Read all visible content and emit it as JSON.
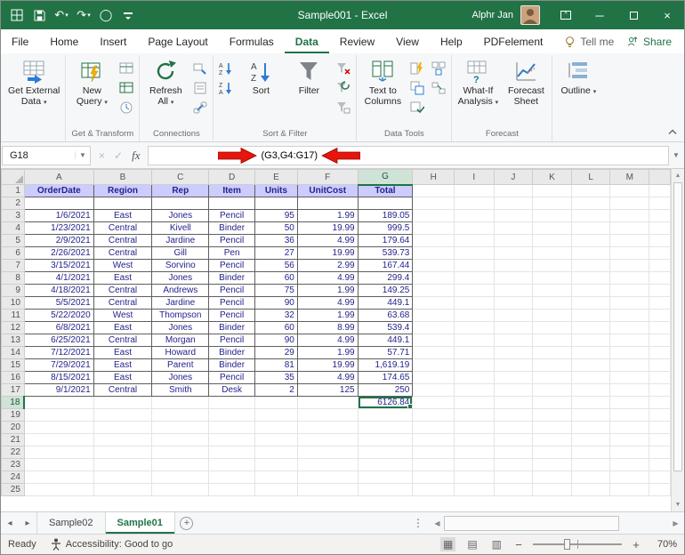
{
  "title_bar": {
    "title": "Sample001  -  Excel",
    "user_name": "Alphr Jan"
  },
  "ribbon_tabs": {
    "items": [
      {
        "label": "File",
        "active": false
      },
      {
        "label": "Home",
        "active": false
      },
      {
        "label": "Insert",
        "active": false
      },
      {
        "label": "Page Layout",
        "active": false
      },
      {
        "label": "Formulas",
        "active": false
      },
      {
        "label": "Data",
        "active": true
      },
      {
        "label": "Review",
        "active": false
      },
      {
        "label": "View",
        "active": false
      },
      {
        "label": "Help",
        "active": false
      },
      {
        "label": "PDFelement",
        "active": false
      }
    ],
    "tell_me": "Tell me",
    "share": "Share"
  },
  "ribbon": {
    "get_external_data": {
      "line1": "Get External",
      "line2": "Data"
    },
    "new_query": {
      "line1": "New",
      "line2": "Query"
    },
    "refresh_all": {
      "line1": "Refresh",
      "line2": "All"
    },
    "sort": "Sort",
    "filter": "Filter",
    "text_to_columns": {
      "line1": "Text to",
      "line2": "Columns"
    },
    "what_if": {
      "line1": "What-If",
      "line2": "Analysis"
    },
    "forecast_sheet": {
      "line1": "Forecast",
      "line2": "Sheet"
    },
    "outline": "Outline",
    "group_labels": [
      "Get & Transform",
      "Connections",
      "Sort & Filter",
      "Data Tools",
      "Forecast"
    ]
  },
  "formula_bar": {
    "name_box": "G18",
    "formula": "(G3,G4:G17)"
  },
  "sheet": {
    "column_letters": [
      "A",
      "B",
      "C",
      "D",
      "E",
      "F",
      "G",
      "H",
      "I",
      "J",
      "K",
      "L",
      "M"
    ],
    "selected_column": "G",
    "selected_row": 18,
    "num_rows": 25,
    "table": {
      "header": [
        "OrderDate",
        "Region",
        "Rep",
        "Item",
        "Units",
        "UnitCost",
        "Total"
      ],
      "rows": [
        [
          "1/6/2021",
          "East",
          "Jones",
          "Pencil",
          "95",
          "1.99",
          "189.05"
        ],
        [
          "1/23/2021",
          "Central",
          "Kivell",
          "Binder",
          "50",
          "19.99",
          "999.5"
        ],
        [
          "2/9/2021",
          "Central",
          "Jardine",
          "Pencil",
          "36",
          "4.99",
          "179.64"
        ],
        [
          "2/26/2021",
          "Central",
          "Gill",
          "Pen",
          "27",
          "19.99",
          "539.73"
        ],
        [
          "3/15/2021",
          "West",
          "Sorvino",
          "Pencil",
          "56",
          "2.99",
          "167.44"
        ],
        [
          "4/1/2021",
          "East",
          "Jones",
          "Binder",
          "60",
          "4.99",
          "299.4"
        ],
        [
          "4/18/2021",
          "Central",
          "Andrews",
          "Pencil",
          "75",
          "1.99",
          "149.25"
        ],
        [
          "5/5/2021",
          "Central",
          "Jardine",
          "Pencil",
          "90",
          "4.99",
          "449.1"
        ],
        [
          "5/22/2020",
          "West",
          "Thompson",
          "Pencil",
          "32",
          "1.99",
          "63.68"
        ],
        [
          "6/8/2021",
          "East",
          "Jones",
          "Binder",
          "60",
          "8.99",
          "539.4"
        ],
        [
          "6/25/2021",
          "Central",
          "Morgan",
          "Pencil",
          "90",
          "4.99",
          "449.1"
        ],
        [
          "7/12/2021",
          "East",
          "Howard",
          "Binder",
          "29",
          "1.99",
          "57.71"
        ],
        [
          "7/29/2021",
          "East",
          "Parent",
          "Binder",
          "81",
          "19.99",
          "1,619.19"
        ],
        [
          "8/15/2021",
          "East",
          "Jones",
          "Pencil",
          "35",
          "4.99",
          "174.65"
        ],
        [
          "9/1/2021",
          "Central",
          "Smith",
          "Desk",
          "2",
          "125",
          "250"
        ]
      ],
      "grand_total": "6126.84"
    }
  },
  "sheet_tabs": {
    "tabs": [
      {
        "label": "Sample02",
        "active": false
      },
      {
        "label": "Sample01",
        "active": true
      }
    ]
  },
  "status_bar": {
    "mode": "Ready",
    "accessibility": "Accessibility: Good to go",
    "zoom_level": "70%"
  },
  "colors": {
    "excel_green": "#217346",
    "table_header_fill": "#ccccff",
    "cell_text_navy": "#23238c",
    "annotation_arrow_red": "#e8150c"
  }
}
